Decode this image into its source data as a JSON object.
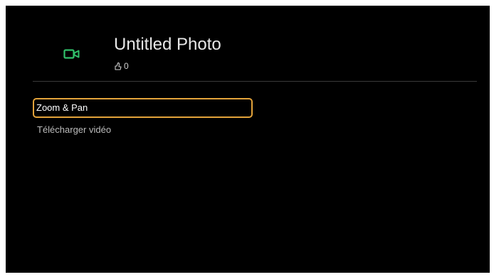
{
  "media": {
    "title": "Untitled Photo",
    "rating_count": "0",
    "type_icon": "video-camera-icon",
    "rating_icon": "thumbs-up-icon"
  },
  "menu": {
    "items": [
      {
        "label": "Zoom & Pan",
        "selected": true
      },
      {
        "label": "Télécharger vidéo",
        "selected": false
      }
    ]
  },
  "colors": {
    "background": "#000000",
    "icon_accent": "#31c06a",
    "selection_border": "#e3a33a",
    "divider": "#3a3a3a"
  }
}
